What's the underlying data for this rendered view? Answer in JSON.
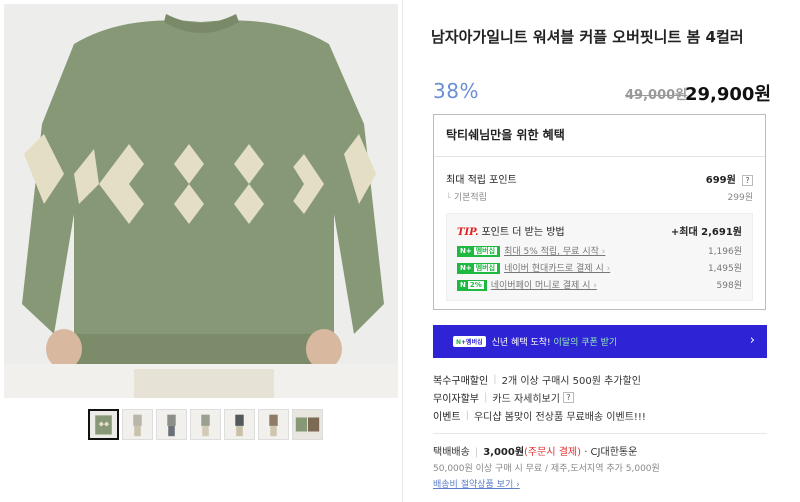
{
  "product": {
    "title": "남자아가일니트 워셔블 커플 오버핏니트 봄 4컬러",
    "discount": "38%",
    "original_price": "49,000원",
    "sale_price": "29,900원"
  },
  "benefit": {
    "heading": "탁티쉐님만을 위한 혜택",
    "points_label": "최대 적립 포인트",
    "points_value": "699원",
    "basic_label": "기본적립",
    "basic_value": "299원",
    "tip_label": "TIP.",
    "tip_text": "포인트 더 받는 방법",
    "tip_max": "+최대 2,691원",
    "tips": [
      {
        "badge": "N+멤버십",
        "text": "최대 5% 적립, 무료 시작",
        "value": "1,196원"
      },
      {
        "badge": "N+멤버십",
        "text": "네이버 현대카드로 결제 시",
        "value": "1,495원"
      },
      {
        "badge": "N2%",
        "text": "네이버페이 머니로 결제 시",
        "value": "598원"
      }
    ]
  },
  "promo": {
    "badge": "N+멤버십",
    "text": "신년 혜택 도착!",
    "highlight": "이달의 쿠폰 받기"
  },
  "info": [
    {
      "key": "복수구매할인",
      "value": "2개 이상 구매시 500원 추가할인"
    },
    {
      "key": "무이자할부",
      "value": "카드 자세히보기"
    },
    {
      "key": "이벤트",
      "value": "우디샵 봄맞이 전상품 무료배송 이벤트!!!"
    }
  ],
  "shipping": {
    "label": "택배배송",
    "fee": "3,000원",
    "fee_note": "(주문시 결제)",
    "carrier": "· CJ대한통운",
    "detail": "50,000원 이상 구매 시 무료 / 제주,도서지역 추가 5,000원",
    "link": "배송비 절약상품 보기"
  },
  "icons": {
    "help": "question-mark-icon",
    "chevron": "chevron-right-icon"
  },
  "colors": {
    "discount": "#6b8fd1",
    "promo_bg": "#2f23d6",
    "naver_green": "#1fb840",
    "tip_red": "#e02020"
  }
}
